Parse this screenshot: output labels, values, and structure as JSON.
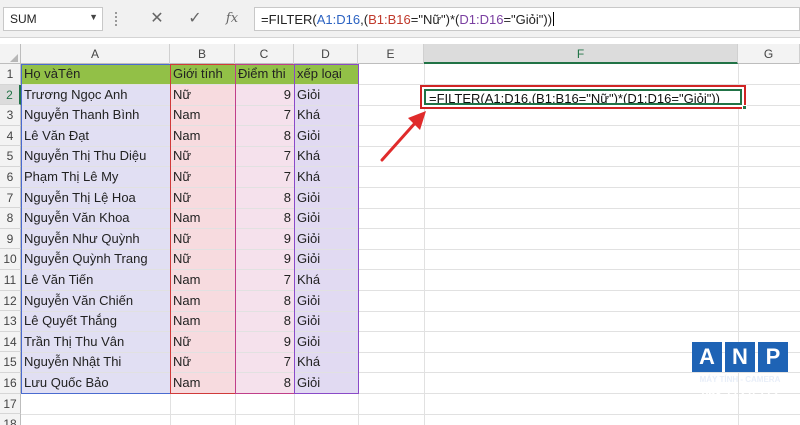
{
  "name_box": {
    "value": "SUM"
  },
  "formula_bar": {
    "cancel_icon": "✕",
    "enter_icon": "✓",
    "fx_label": "fx",
    "parts": [
      "=FILTER(",
      "A1:D16",
      ",(",
      "B1:B16",
      "=\"Nữ\")*(",
      "D1:D16",
      "=\"Giỏi\"))"
    ]
  },
  "columns": [
    "A",
    "B",
    "C",
    "D",
    "E",
    "F",
    "G"
  ],
  "rows": [
    "1",
    "2",
    "3",
    "4",
    "5",
    "6",
    "7",
    "8",
    "9",
    "10",
    "11",
    "12",
    "13",
    "14",
    "15",
    "16",
    "17",
    "18"
  ],
  "table": {
    "headers": [
      "Họ vàTên",
      "Giới tính",
      "Điểm thi",
      "xếp loại"
    ],
    "rows": [
      [
        "Trương Ngọc Anh",
        "Nữ",
        "9",
        "Giỏi"
      ],
      [
        "Nguyễn Thanh Bình",
        "Nam",
        "7",
        "Khá"
      ],
      [
        "Lê Văn Đạt",
        "Nam",
        "8",
        "Giỏi"
      ],
      [
        "Nguyễn Thị Thu Diệu",
        "Nữ",
        "7",
        "Khá"
      ],
      [
        "Phạm Thị Lê My",
        "Nữ",
        "7",
        "Khá"
      ],
      [
        "Nguyễn Thị Lệ Hoa",
        "Nữ",
        "8",
        "Giỏi"
      ],
      [
        "Nguyễn Văn Khoa",
        "Nam",
        "8",
        "Giỏi"
      ],
      [
        "Nguyễn Như Quỳnh",
        "Nữ",
        "9",
        "Giỏi"
      ],
      [
        "Nguyễn Quỳnh Trang",
        "Nữ",
        "9",
        "Giỏi"
      ],
      [
        "Lê Văn Tiến",
        "Nam",
        "7",
        "Khá"
      ],
      [
        "Nguyễn Văn Chiến",
        "Nam",
        "8",
        "Giỏi"
      ],
      [
        "Lê Quyết Thắng",
        "Nam",
        "8",
        "Giỏi"
      ],
      [
        "Trần Thị Thu Vân",
        "Nữ",
        "9",
        "Giỏi"
      ],
      [
        "Nguyễn Nhật Thi",
        "Nữ",
        "7",
        "Khá"
      ],
      [
        "Lưu Quốc Bảo",
        "Nam",
        "8",
        "Giỏi"
      ]
    ]
  },
  "active_cell": {
    "ref": "F2",
    "formula": "=FILTER(A1:D16,(B1:B16=\"Nữ\")*(D1:D16=\"Giỏi\"))"
  },
  "logo": {
    "letters": [
      "A",
      "N",
      "P"
    ],
    "line1": "MÁY TÍNH - CAMERA",
    "line2": "098 772 0 772",
    "line3": "WWW.ANP.COM.VN"
  },
  "colors": {
    "header_fill": "#92c047",
    "excel_green": "#217346",
    "annotation_red": "#d02424",
    "logo_blue": "#1e63b5"
  }
}
